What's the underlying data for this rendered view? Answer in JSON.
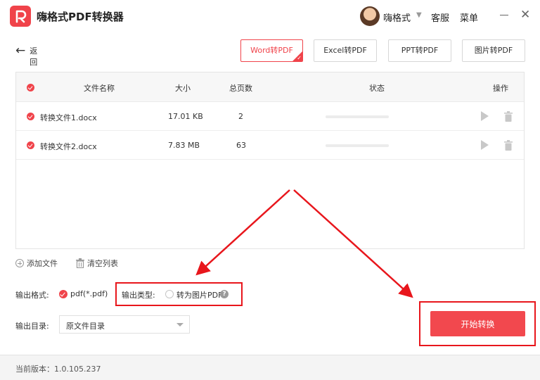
{
  "app": {
    "title": "嗨格式PDF转换器",
    "logo_icon": "pdf-converter-logo",
    "accent": "#f0434a"
  },
  "header": {
    "user_name": "嗨格式",
    "support": "客服",
    "menu": "菜单"
  },
  "nav": {
    "back_label": "返回"
  },
  "tabs": [
    {
      "label": "Word转PDF",
      "active": true
    },
    {
      "label": "Excel转PDF",
      "active": false
    },
    {
      "label": "PPT转PDF",
      "active": false
    },
    {
      "label": "图片转PDF",
      "active": false
    }
  ],
  "table": {
    "headers": {
      "name": "文件名称",
      "size": "大小",
      "pages": "总页数",
      "status": "状态",
      "actions": "操作"
    },
    "rows": [
      {
        "name": "转换文件1.docx",
        "size": "17.01 KB",
        "pages": "2",
        "progress": 0
      },
      {
        "name": "转换文件2.docx",
        "size": "7.83 MB",
        "pages": "63",
        "progress": 0
      }
    ]
  },
  "tools": {
    "add_file": "添加文件",
    "clear_list": "清空列表"
  },
  "options": {
    "format_label": "输出格式:",
    "format_value": "pdf(*.pdf)",
    "type_label": "输出类型:",
    "type_option": "转为图片PDF",
    "type_help": "?",
    "dir_label": "输出目录:",
    "dir_value": "原文件目录"
  },
  "actions": {
    "start_label": "开始转换"
  },
  "footer": {
    "version": "当前版本：1.0.105.237"
  }
}
